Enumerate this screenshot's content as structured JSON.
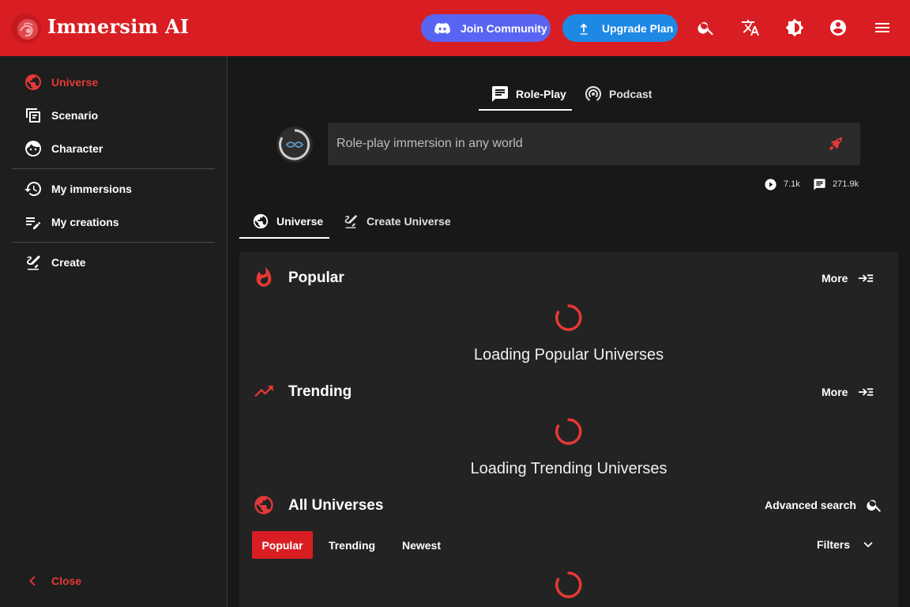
{
  "header": {
    "brand": "Immersim AI",
    "join_label": "Join Community",
    "upgrade_label": "Upgrade Plan"
  },
  "sidebar": {
    "items": [
      {
        "label": "Universe",
        "active": true
      },
      {
        "label": "Scenario"
      },
      {
        "label": "Character"
      },
      {
        "label": "My immersions"
      },
      {
        "label": "My creations"
      },
      {
        "label": "Create"
      }
    ],
    "close_label": "Close"
  },
  "main": {
    "mode_tabs": [
      "Role-Play",
      "Podcast"
    ],
    "search_placeholder": "Role-play immersion in any world",
    "stats": {
      "plays": "7.1k",
      "messages": "271.9k"
    },
    "sub_tabs": [
      "Universe",
      "Create Universe"
    ],
    "sections": {
      "popular": {
        "title": "Popular",
        "more": "More",
        "loading": "Loading Popular Universes"
      },
      "trending": {
        "title": "Trending",
        "more": "More",
        "loading": "Loading Trending Universes"
      },
      "all": {
        "title": "All Universes",
        "advanced": "Advanced search",
        "filters": "Filters"
      }
    },
    "chips": [
      "Popular",
      "Trending",
      "Newest"
    ]
  },
  "colors": {
    "accent": "#d81e23",
    "discord": "#5865f2",
    "upgrade": "#1e88e5"
  }
}
